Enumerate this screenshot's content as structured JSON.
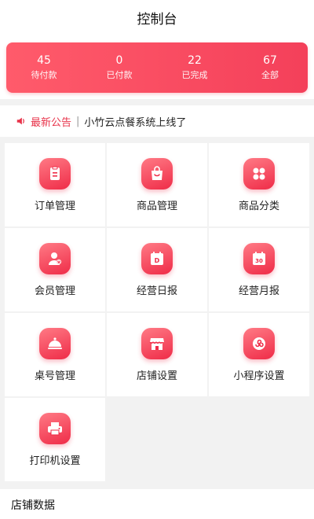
{
  "header": {
    "title": "控制台"
  },
  "stats": [
    {
      "value": "45",
      "label": "待付款"
    },
    {
      "value": "0",
      "label": "已付款"
    },
    {
      "value": "22",
      "label": "已完成"
    },
    {
      "value": "67",
      "label": "全部"
    }
  ],
  "notice": {
    "tag": "最新公告",
    "separator": "|",
    "text": "小竹云点餐系统上线了",
    "icon": "speaker-icon"
  },
  "menu": [
    {
      "label": "订单管理",
      "icon": "clipboard-icon"
    },
    {
      "label": "商品管理",
      "icon": "shopping-bag-icon"
    },
    {
      "label": "商品分类",
      "icon": "grid-icon"
    },
    {
      "label": "会员管理",
      "icon": "member-icon"
    },
    {
      "label": "经营日报",
      "icon": "calendar-day-icon"
    },
    {
      "label": "经营月报",
      "icon": "calendar-month-icon"
    },
    {
      "label": "桌号管理",
      "icon": "cloche-icon"
    },
    {
      "label": "店铺设置",
      "icon": "store-icon"
    },
    {
      "label": "小程序设置",
      "icon": "mini-program-icon"
    },
    {
      "label": "打印机设置",
      "icon": "printer-icon"
    }
  ],
  "section": {
    "title": "店铺数据"
  },
  "icon_glyphs": {
    "calendar_day": "D",
    "calendar_month": "30"
  },
  "colors": {
    "accent": "#ef2c48",
    "accent_light": "#ff7a85",
    "notice_tag": "#e8334a"
  }
}
